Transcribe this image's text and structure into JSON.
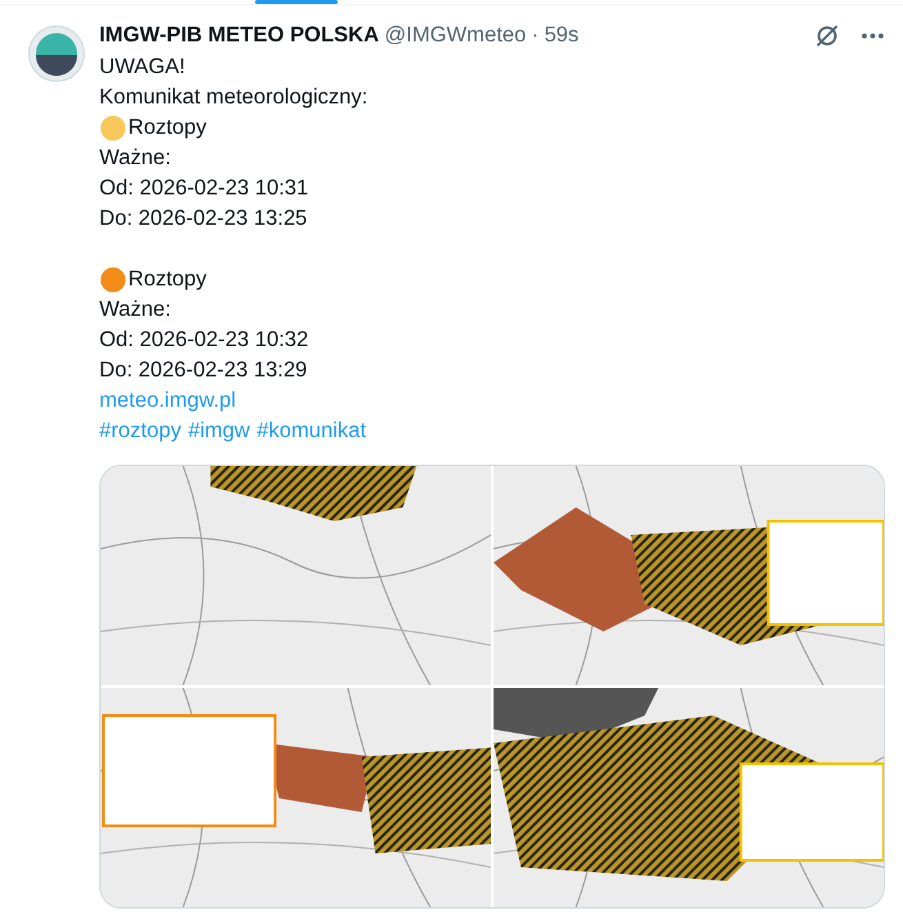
{
  "author": {
    "name": "IMGW-PIB METEO POLSKA",
    "handle": "@IMGWmeteo",
    "separator": "·",
    "time": "59s"
  },
  "text": {
    "intro": [
      "UWAGA!",
      "Komunikat meteorologiczny:"
    ],
    "alerts": [
      {
        "title": "Roztopy",
        "color": "#f7c75a",
        "lines": [
          "Ważne:",
          "Od: 2026-02-23 10:31",
          "Do: 2026-02-23 13:25"
        ]
      },
      {
        "title": "Roztopy",
        "color": "#f28c17",
        "lines": [
          "Ważne:",
          "Od: 2026-02-23 10:32",
          "Do: 2026-02-23 13:29"
        ]
      }
    ],
    "link": "meteo.imgw.pl",
    "hashtags": [
      "#roztopy",
      "#imgw",
      "#komunikat"
    ]
  }
}
